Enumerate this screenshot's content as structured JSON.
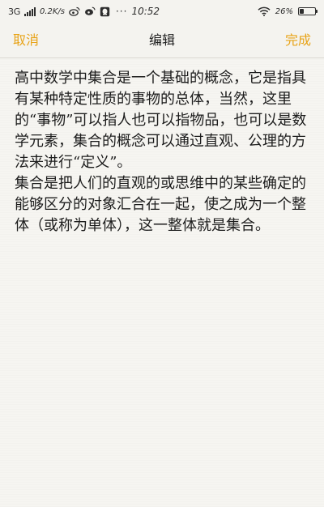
{
  "status_bar": {
    "network": "3G",
    "speed": "0.2K/s",
    "time": "10:52",
    "battery_percent": "26%",
    "battery_level": 0.26,
    "icons": [
      "signal-icon",
      "weibo-icon",
      "weibo-alt-icon",
      "chat-icon",
      "notification-icon",
      "wifi-icon",
      "battery-icon"
    ]
  },
  "nav": {
    "cancel_label": "取消",
    "title": "编辑",
    "done_label": "完成",
    "accent_color": "#e8a317"
  },
  "note": {
    "paragraphs": [
      "高中数学中集合是一个基础的概念，它是指具有某种特定性质的事物的总体，当然，这里的“事物”可以指人也可以指物品，也可以是数学元素，集合的概念可以通过直观、公理的方法来进行“定义”。",
      "集合是把人们的直观的或思维中的某些确定的能够区分的对象汇合在一起，使之成为一个整体（或称为单体），这一整体就是集合。"
    ]
  }
}
